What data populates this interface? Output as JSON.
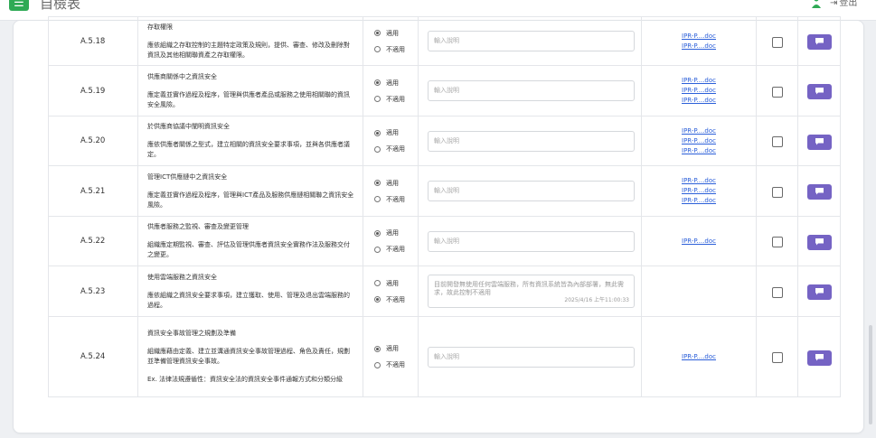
{
  "app": {
    "title": "自檢表",
    "logout_label": "登出"
  },
  "options": {
    "applicable": "適用",
    "not_applicable": "不適用"
  },
  "rows": [
    {
      "code": "A.5.18",
      "title": "存取權限",
      "body": "應依組織之存取控制的主題特定政策及規則，提供、審查、修改及刪除對資訊及其他相關聯資產之存取權限。",
      "note": "",
      "selected": "applicable",
      "note_placeholder": "輸入說明",
      "stamp": "",
      "docs": [
        "IPR-P....doc",
        "IPR-P....doc"
      ]
    },
    {
      "code": "A.5.19",
      "title": "供應商關係中之資訊安全",
      "body": "應定義並實作過程及程序，管理與供應者產品或服務之使用相關聯的資訊安全風險。",
      "note": "",
      "selected": "applicable",
      "note_placeholder": "輸入說明",
      "stamp": "",
      "docs": [
        "IPR-P....doc",
        "IPR-P....doc",
        "IPR-P....doc"
      ]
    },
    {
      "code": "A.5.20",
      "title": "於供應商協議中闡明資訊安全",
      "body": "應依供應者關係之型式，建立相關的資訊安全要求事項，並與各供應者議定。",
      "note": "",
      "selected": "applicable",
      "note_placeholder": "輸入說明",
      "stamp": "",
      "docs": [
        "IPR-P....doc",
        "IPR-P....doc",
        "IPR-P....doc"
      ]
    },
    {
      "code": "A.5.21",
      "title": "管理ICT供應鏈中之資訊安全",
      "body": "應定義並實作過程及程序，管理與ICT產品及服務供應鏈相關聯之資訊安全風險。",
      "note": "",
      "selected": "applicable",
      "note_placeholder": "輸入說明",
      "stamp": "",
      "docs": [
        "IPR-P....doc",
        "IPR-P....doc",
        "IPR-P....doc"
      ]
    },
    {
      "code": "A.5.22",
      "title": "供應者服務之監視、審查及變更管理",
      "body": "組織應定期監視、審查、評估及管理供應者資訊安全實務作法及服務交付之變更。",
      "note": "",
      "selected": "applicable",
      "note_placeholder": "輸入說明",
      "stamp": "",
      "docs": [
        "IPR-P....doc"
      ]
    },
    {
      "code": "A.5.23",
      "title": "使用雲端服務之資訊安全",
      "body": "應依組織之資訊安全要求事項，建立獲取、使用、管理及退出雲端服務的過程。",
      "note": "目前開發無使用任何雲端服務，所有資訊系統皆為內部部署，無此需求，故此控制不適用",
      "selected": "not_applicable",
      "note_placeholder": "輸入說明",
      "stamp": "2025/4/16 上午11:00:33",
      "docs": []
    },
    {
      "code": "A.5.24",
      "title": "資訊安全事故管理之規劃及準備",
      "body": "組織應藉由定義、建立並溝通資訊安全事故管理過程、角色及責任，規劃並準備管理資訊安全事故。",
      "extra": "Ex. 法律法規遵循性：資訊安全法的資訊安全事件通報方式和分類分級",
      "note": "",
      "selected": "applicable",
      "note_placeholder": "輸入說明",
      "stamp": "",
      "docs": [
        "IPR-P....doc"
      ]
    }
  ],
  "colors": {
    "menu_green": "#2eaa55",
    "comment_purple": "#7563c4",
    "link_blue": "#2b5fd9"
  },
  "icons": {
    "menu": "hamburger-icon",
    "user": "user-icon",
    "logout": "logout-arrow-icon",
    "comment": "comment-icon"
  }
}
